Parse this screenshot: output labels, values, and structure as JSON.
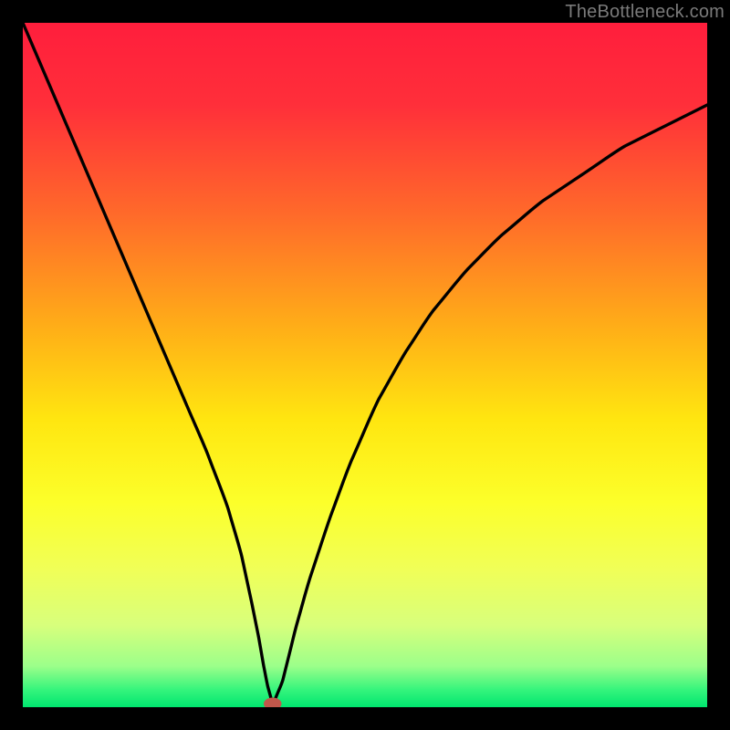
{
  "attribution": "TheBottleneck.com",
  "chart_data": {
    "type": "line",
    "title": "",
    "xlabel": "",
    "ylabel": "",
    "xlim": [
      0,
      100
    ],
    "ylim": [
      0,
      100
    ],
    "gradient_stops": [
      {
        "offset": 0.0,
        "color": "#ff1e3c"
      },
      {
        "offset": 0.12,
        "color": "#ff2f3a"
      },
      {
        "offset": 0.28,
        "color": "#ff6a2a"
      },
      {
        "offset": 0.45,
        "color": "#ffb017"
      },
      {
        "offset": 0.58,
        "color": "#ffe610"
      },
      {
        "offset": 0.7,
        "color": "#fcff2a"
      },
      {
        "offset": 0.8,
        "color": "#f0ff58"
      },
      {
        "offset": 0.88,
        "color": "#d8ff7c"
      },
      {
        "offset": 0.94,
        "color": "#9cff8a"
      },
      {
        "offset": 0.975,
        "color": "#34f47c"
      },
      {
        "offset": 1.0,
        "color": "#00e66f"
      }
    ],
    "series": [
      {
        "name": "curve",
        "x": [
          0,
          3,
          6,
          9,
          12,
          15,
          18,
          21,
          24,
          27,
          30,
          32,
          33.5,
          34.5,
          35.2,
          35.8,
          36.3,
          36.5,
          37,
          38,
          39,
          40,
          42,
          45,
          48,
          52,
          56,
          60,
          65,
          70,
          76,
          82,
          88,
          94,
          100
        ],
        "y": [
          100,
          93,
          86,
          79,
          72,
          65,
          58,
          51,
          44,
          37,
          29,
          22,
          15,
          10,
          6,
          3,
          1.2,
          0.5,
          1.5,
          4,
          8,
          12,
          19,
          28,
          36,
          45,
          52,
          58,
          64,
          69,
          74,
          78,
          82,
          85,
          88
        ]
      }
    ],
    "marker": {
      "x": 36.5,
      "y": 0.5,
      "rx": 1.3,
      "ry": 0.9,
      "color": "#c1574b"
    }
  }
}
